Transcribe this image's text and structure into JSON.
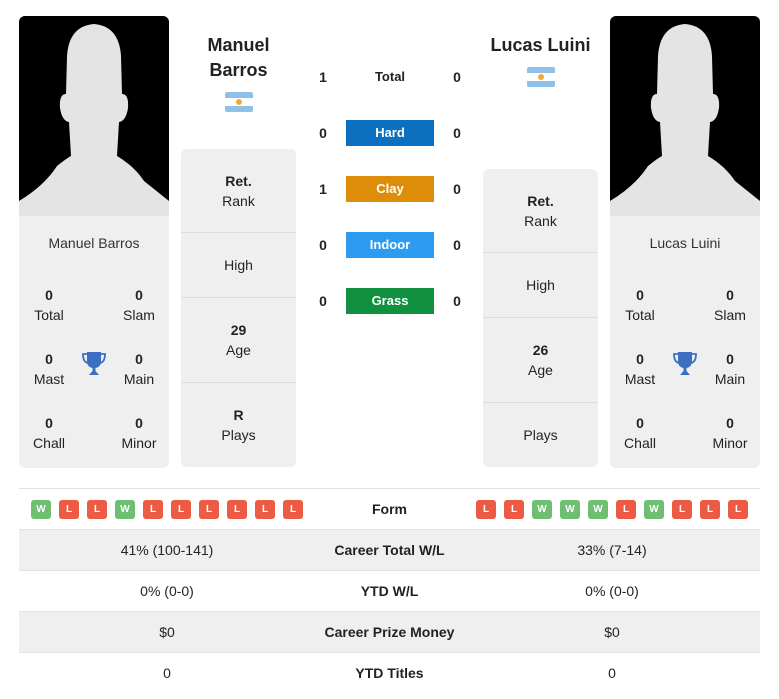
{
  "player1": {
    "name_line1": "Manuel",
    "name_line2": "Barros",
    "card_name": "Manuel Barros",
    "flag": "argentina-flag",
    "titles": {
      "total": {
        "value": "0",
        "label": "Total"
      },
      "slam": {
        "value": "0",
        "label": "Slam"
      },
      "mast": {
        "value": "0",
        "label": "Mast"
      },
      "main": {
        "value": "0",
        "label": "Main"
      },
      "chall": {
        "value": "0",
        "label": "Chall"
      },
      "minor": {
        "value": "0",
        "label": "Minor"
      }
    },
    "stats": {
      "rank": {
        "value": "Ret.",
        "label": "Rank"
      },
      "high": {
        "value": "",
        "label": "High"
      },
      "age": {
        "value": "29",
        "label": "Age"
      },
      "plays": {
        "value": "R",
        "label": "Plays"
      }
    }
  },
  "player2": {
    "name": "Lucas Luini",
    "card_name": "Lucas Luini",
    "flag": "argentina-flag",
    "titles": {
      "total": {
        "value": "0",
        "label": "Total"
      },
      "slam": {
        "value": "0",
        "label": "Slam"
      },
      "mast": {
        "value": "0",
        "label": "Mast"
      },
      "main": {
        "value": "0",
        "label": "Main"
      },
      "chall": {
        "value": "0",
        "label": "Chall"
      },
      "minor": {
        "value": "0",
        "label": "Minor"
      }
    },
    "stats": {
      "rank": {
        "value": "Ret.",
        "label": "Rank"
      },
      "high": {
        "value": "",
        "label": "High"
      },
      "age": {
        "value": "26",
        "label": "Age"
      },
      "plays": {
        "value": "",
        "label": "Plays"
      }
    }
  },
  "h2h": [
    {
      "label": "Total",
      "p1": "1",
      "p2": "0",
      "color": ""
    },
    {
      "label": "Hard",
      "p1": "0",
      "p2": "0",
      "color": "#0c6fc0"
    },
    {
      "label": "Clay",
      "p1": "1",
      "p2": "0",
      "color": "#dd8d0a"
    },
    {
      "label": "Indoor",
      "p1": "0",
      "p2": "0",
      "color": "#2d9bf0"
    },
    {
      "label": "Grass",
      "p1": "0",
      "p2": "0",
      "color": "#119140"
    }
  ],
  "comparison": {
    "form_label": "Form",
    "p1_form": [
      "W",
      "L",
      "L",
      "W",
      "L",
      "L",
      "L",
      "L",
      "L",
      "L"
    ],
    "p2_form": [
      "L",
      "L",
      "W",
      "W",
      "W",
      "L",
      "W",
      "L",
      "L",
      "L"
    ],
    "rows": [
      {
        "label": "Career Total W/L",
        "p1": "41% (100-141)",
        "p2": "33% (7-14)"
      },
      {
        "label": "YTD W/L",
        "p1": "0% (0-0)",
        "p2": "0% (0-0)"
      },
      {
        "label": "Career Prize Money",
        "p1": "$0",
        "p2": "$0"
      },
      {
        "label": "YTD Titles",
        "p1": "0",
        "p2": "0"
      }
    ]
  },
  "colors": {
    "win": "#6fbf73",
    "loss": "#ec5c45",
    "trophy": "#3a6fc2"
  }
}
